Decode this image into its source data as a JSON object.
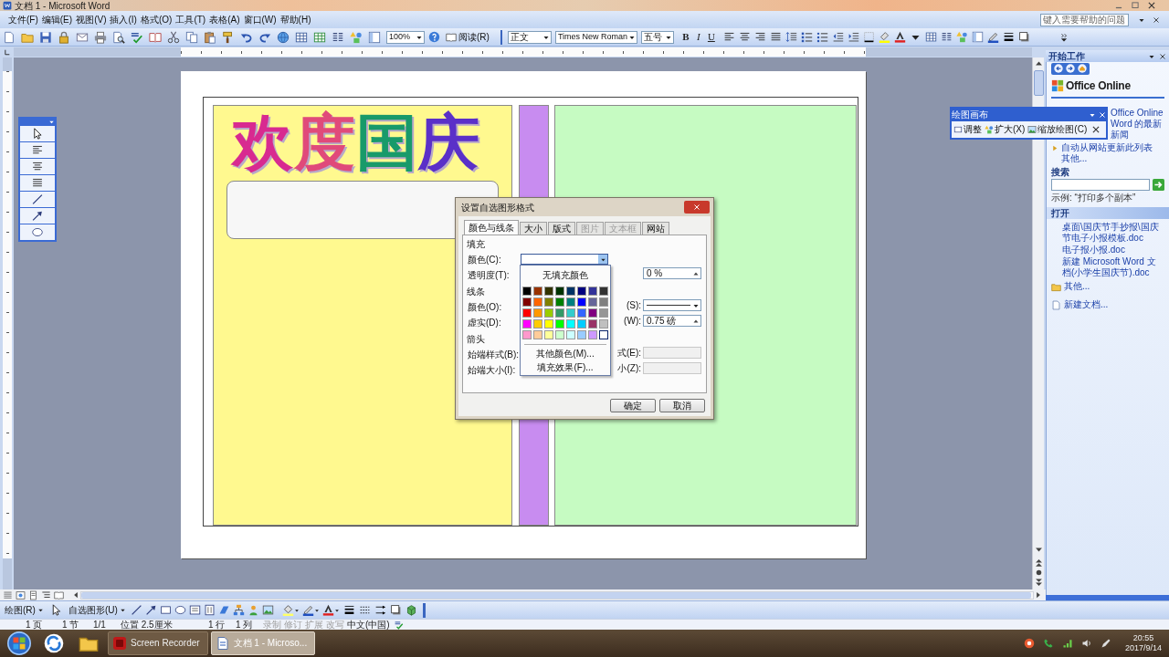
{
  "window": {
    "title": "文档 1 - Microsoft Word"
  },
  "menu": [
    "文件(F)",
    "编辑(E)",
    "视图(V)",
    "插入(I)",
    "格式(O)",
    "工具(T)",
    "表格(A)",
    "窗口(W)",
    "帮助(H)"
  ],
  "help_box": {
    "placeholder": "键入需要帮助的问题"
  },
  "toolbar": {
    "zoom": "100%",
    "read_button": "阅读(R)",
    "style": "正文",
    "font": "Times New Roman",
    "size": "五号",
    "format_buttons": [
      "B",
      "I",
      "U"
    ]
  },
  "document": {
    "wordart": "欢度国庆",
    "shapes": [
      {
        "color": "#fff98f"
      },
      {
        "color": "#c88cf0"
      },
      {
        "color": "#c6fbc2"
      }
    ]
  },
  "canvas_toolbar": {
    "title": "绘图画布",
    "buttons": [
      "调整",
      "扩大(X)",
      "缩放绘图(C)"
    ]
  },
  "task_pane": {
    "title": "开始工作",
    "logo": "Office Online",
    "links": [
      "Office Online",
      "Word 的最新新闻"
    ],
    "update_link": "自动从网站更新此列表",
    "more_link": "其他...",
    "search": {
      "label": "搜索",
      "example": "示例: “打印多个副本”"
    },
    "open": {
      "title": "打开",
      "files": [
        "桌面\\国庆节手抄报\\国庆节电子小报模板.doc",
        "电子报小报.doc",
        "新建 Microsoft Word 文档(小学生国庆节).doc"
      ],
      "more": "其他...",
      "new": "新建文档..."
    }
  },
  "dialog": {
    "title": "设置自选图形格式",
    "tabs": [
      {
        "label": "颜色与线条",
        "selected": true,
        "disabled": false
      },
      {
        "label": "大小",
        "selected": false,
        "disabled": false
      },
      {
        "label": "版式",
        "selected": false,
        "disabled": false
      },
      {
        "label": "图片",
        "selected": false,
        "disabled": true
      },
      {
        "label": "文本框",
        "selected": false,
        "disabled": true
      },
      {
        "label": "网站",
        "selected": false,
        "disabled": false
      }
    ],
    "sections": [
      {
        "title": "填充",
        "rows": [
          {
            "label": "颜色(C):",
            "kind": "none"
          },
          {
            "label": "透明度(T):",
            "kind": "spin",
            "value": "0 %"
          }
        ]
      },
      {
        "title": "线条",
        "rows": [
          {
            "label": "颜色(O):",
            "kind": "line",
            "right_label": "(S):"
          },
          {
            "label": "虚实(D):",
            "kind": "spin",
            "right_label": "(W):",
            "value": "0.75 磅"
          }
        ]
      },
      {
        "title": "箭头",
        "rows": [
          {
            "label": "始端样式(B):",
            "kind": "disabled",
            "right_label": "式(E):"
          },
          {
            "label": "始端大小(I):",
            "kind": "disabled",
            "right_label": "小(Z):"
          }
        ]
      }
    ],
    "color_picker": {
      "no_fill": "无填充颜色",
      "swatches": [
        {
          "color": "#000000",
          "selected": false
        },
        {
          "color": "#993300",
          "selected": false
        },
        {
          "color": "#333300",
          "selected": false
        },
        {
          "color": "#003300",
          "selected": false
        },
        {
          "color": "#003366",
          "selected": false
        },
        {
          "color": "#000080",
          "selected": false
        },
        {
          "color": "#333399",
          "selected": false
        },
        {
          "color": "#333333",
          "selected": false
        },
        {
          "color": "#800000",
          "selected": false
        },
        {
          "color": "#ff6600",
          "selected": false
        },
        {
          "color": "#808000",
          "selected": false
        },
        {
          "color": "#008000",
          "selected": false
        },
        {
          "color": "#008080",
          "selected": false
        },
        {
          "color": "#0000ff",
          "selected": false
        },
        {
          "color": "#666699",
          "selected": false
        },
        {
          "color": "#808080",
          "selected": false
        },
        {
          "color": "#ff0000",
          "selected": false
        },
        {
          "color": "#ff9900",
          "selected": false
        },
        {
          "color": "#99cc00",
          "selected": false
        },
        {
          "color": "#339966",
          "selected": false
        },
        {
          "color": "#33cccc",
          "selected": false
        },
        {
          "color": "#3366ff",
          "selected": false
        },
        {
          "color": "#800080",
          "selected": false
        },
        {
          "color": "#969696",
          "selected": false
        },
        {
          "color": "#ff00ff",
          "selected": false
        },
        {
          "color": "#ffcc00",
          "selected": false
        },
        {
          "color": "#ffff00",
          "selected": false
        },
        {
          "color": "#00ff00",
          "selected": false
        },
        {
          "color": "#00ffff",
          "selected": false
        },
        {
          "color": "#00ccff",
          "selected": false
        },
        {
          "color": "#993366",
          "selected": false
        },
        {
          "color": "#c0c0c0",
          "selected": false
        },
        {
          "color": "#ff99cc",
          "selected": false
        },
        {
          "color": "#ffcc99",
          "selected": false
        },
        {
          "color": "#ffff99",
          "selected": false
        },
        {
          "color": "#ccffcc",
          "selected": false
        },
        {
          "color": "#ccffff",
          "selected": false
        },
        {
          "color": "#99ccff",
          "selected": false
        },
        {
          "color": "#cc99ff",
          "selected": false
        },
        {
          "color": "#ffffff",
          "selected": true
        }
      ],
      "more_colors": "其他颜色(M)...",
      "fill_effects": "填充效果(F)..."
    },
    "buttons": [
      "确定",
      "取消"
    ]
  },
  "drawing_toolbar": {
    "buttons": [
      "绘图(R)",
      "自选图形(U)"
    ]
  },
  "status_bar": {
    "items": [
      {
        "text": "1 页",
        "disabled": false
      },
      {
        "text": "1 节",
        "disabled": false
      },
      {
        "text": "1/1",
        "disabled": false
      },
      {
        "text": "位置 2.5厘米",
        "disabled": false
      },
      {
        "text": "1 行",
        "disabled": false
      },
      {
        "text": "1 列",
        "disabled": false
      },
      {
        "text": "录制",
        "disabled": true
      },
      {
        "text": "修订",
        "disabled": true
      },
      {
        "text": "扩展",
        "disabled": true
      },
      {
        "text": "改写",
        "disabled": true
      },
      {
        "text": "中文(中国)",
        "disabled": false
      }
    ]
  },
  "taskbar": {
    "windows": [
      {
        "label": "Screen Recorder",
        "selected": false
      },
      {
        "label": "文档 1 - Microso...",
        "selected": true
      }
    ],
    "time": "20:55",
    "date": "2017/9/14"
  }
}
